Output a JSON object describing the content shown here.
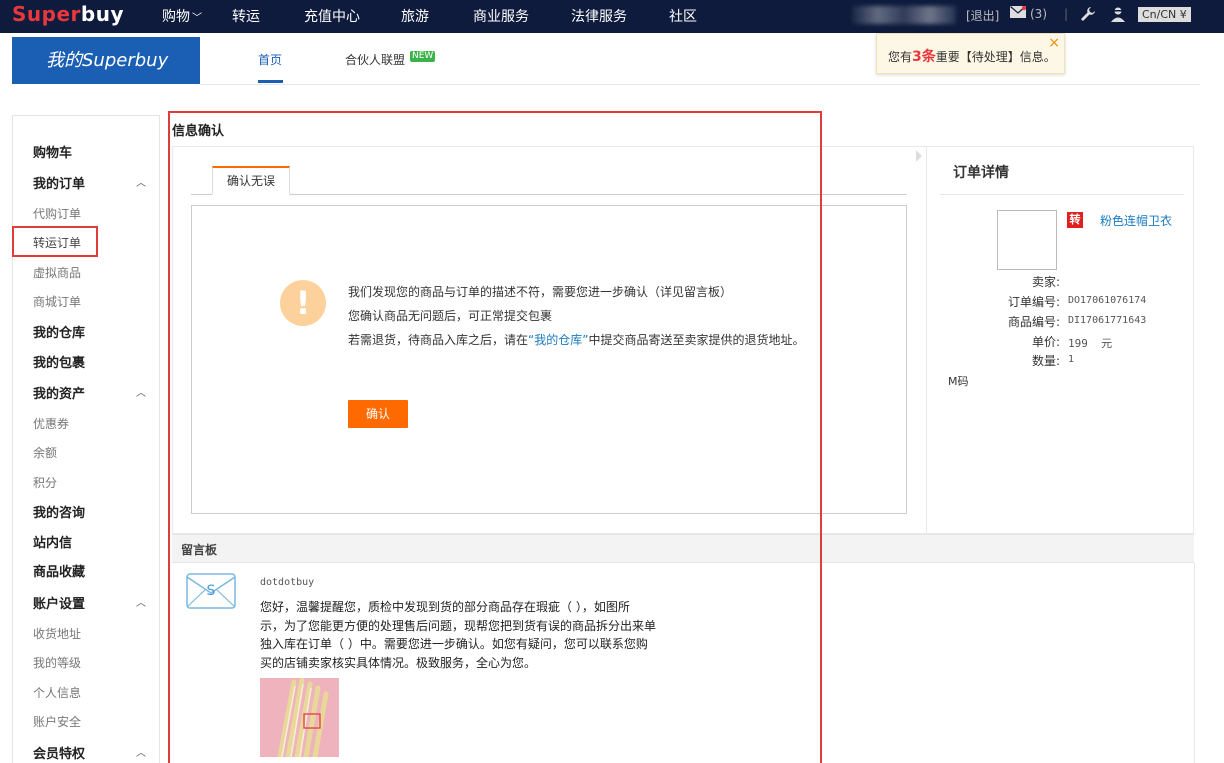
{
  "topnav": {
    "logo_a": "Super",
    "logo_b": "buy",
    "items": [
      "购物",
      "转运",
      "充值中心",
      "旅游",
      "商业服务",
      "法律服务",
      "社区"
    ],
    "caret": "﹀",
    "logout": "[退出]",
    "mail_count": "(3)",
    "divider": "|",
    "lang": "Cn/CN ¥"
  },
  "subheader": {
    "brand": "我的Superbuy",
    "tab_home": "首页",
    "tab_partner": "合伙人联盟",
    "badge_new": "NEW"
  },
  "notice": {
    "prefix": "您有",
    "count": "3条",
    "suffix": "重要【待处理】信息。",
    "close": "×"
  },
  "sidebar": {
    "items": [
      {
        "label": "购物车",
        "type": "h"
      },
      {
        "label": "我的订单",
        "type": "h",
        "expanded": true
      },
      {
        "label": "代购订单",
        "type": "sub"
      },
      {
        "label": "转运订单",
        "type": "sub"
      },
      {
        "label": "虚拟商品",
        "type": "sub"
      },
      {
        "label": "商城订单",
        "type": "sub"
      },
      {
        "label": "我的仓库",
        "type": "h"
      },
      {
        "label": "我的包裹",
        "type": "h"
      },
      {
        "label": "我的资产",
        "type": "h",
        "expanded": true
      },
      {
        "label": "优惠券",
        "type": "sub"
      },
      {
        "label": "余额",
        "type": "sub"
      },
      {
        "label": "积分",
        "type": "sub"
      },
      {
        "label": "我的咨询",
        "type": "h"
      },
      {
        "label": "站内信",
        "type": "h"
      },
      {
        "label": "商品收藏",
        "type": "h"
      },
      {
        "label": "账户设置",
        "type": "h",
        "expanded": true
      },
      {
        "label": "收货地址",
        "type": "sub"
      },
      {
        "label": "我的等级",
        "type": "sub"
      },
      {
        "label": "个人信息",
        "type": "sub"
      },
      {
        "label": "账户安全",
        "type": "sub"
      },
      {
        "label": "会员特权",
        "type": "h",
        "expanded": true
      }
    ],
    "caret_up": "︿"
  },
  "main": {
    "title": "信息确认",
    "tab": "确认无误",
    "warn_glyph": "!",
    "msg1": "我们发现您的商品与订单的描述不符，需要您进一步确认（详见留言板）",
    "msg2": "您确认商品无问题后，可正常提交包裹",
    "msg3_a": "若需退货，待商品入库之后，请在",
    "msg3_link": "“我的仓库”",
    "msg3_b": "中提交商品寄送至卖家提供的退货地址。",
    "confirm_btn": "确认"
  },
  "order": {
    "title": "订单详情",
    "tag": "转",
    "name": "粉色连帽卫衣",
    "seller_label": "卖家:",
    "order_no_label": "订单编号:",
    "order_no": "DO17061076174",
    "item_no_label": "商品编号:",
    "item_no": "DI17061771643",
    "price_label": "单价:",
    "price": "199  元",
    "qty_label": "数量:",
    "qty": "1",
    "size": "M码"
  },
  "board": {
    "title": "留言板",
    "user": "dotdotbuy",
    "lines": [
      "您好，温馨提醒您，质检中发现到货的部分商品存在瑕疵（ ），如图所",
      "示，为了您能更方便的处理售后问题，现帮您把到货有误的商品拆分出来单",
      "独入库在订单（ ）中。需要您进一步确认。如您有疑问，您可以联系您购",
      "买的店铺卖家核实具体情况。极致服务，全心为您。"
    ]
  },
  "colors": {
    "nav_bg": "#0e1b3d",
    "brand_blue": "#1a5fb4",
    "accent_orange": "#ff6a00",
    "highlight_red": "#e03c3c"
  }
}
